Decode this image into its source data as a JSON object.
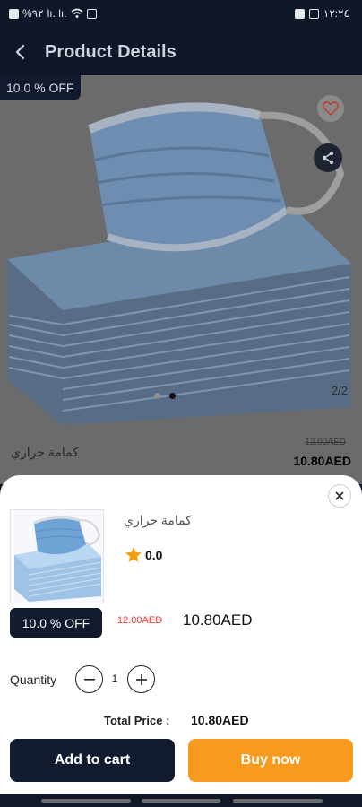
{
  "status_bar": {
    "left_text": "%٩٢",
    "signal_text": "lı. lı.",
    "time": "١٢:٢٤"
  },
  "app_bar": {
    "title": "Product Details"
  },
  "product": {
    "discount_tag": "10.0 % OFF",
    "page_counter": "2/2",
    "total_images": 2,
    "active_image_index": 2,
    "name": "كمامة حراري",
    "old_price": "12.00AED",
    "price": "10.80AED"
  },
  "sheet": {
    "name": "كمامة حراري",
    "rating": "0.0",
    "discount": "10.0 % OFF",
    "old_price": "12.00AED",
    "price": "10.80AED",
    "quantity_label": "Quantity",
    "quantity": "1",
    "total_label": "Total Price :",
    "total_value": "10.80AED",
    "add_to_cart": "Add to cart",
    "buy_now": "Buy now"
  },
  "colors": {
    "primary_dark": "#121a2e",
    "accent_orange": "#f79a1e",
    "strike_red": "#e23b3b",
    "star_orange": "#f59e0b"
  }
}
